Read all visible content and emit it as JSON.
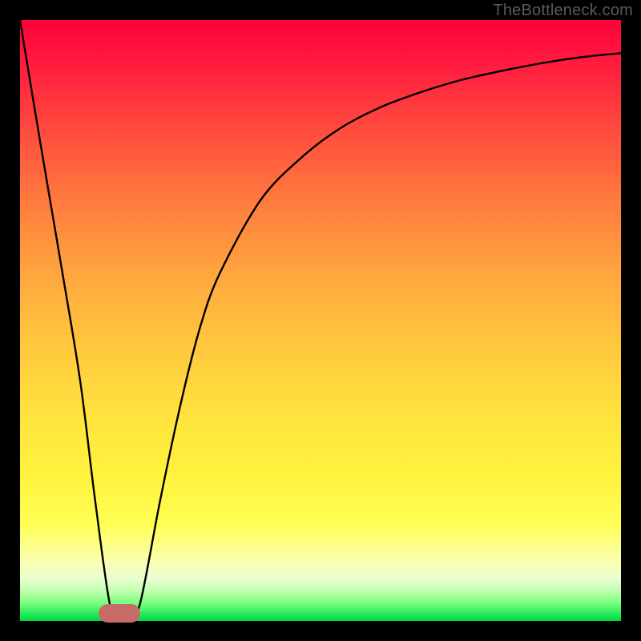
{
  "watermark": "TheBottleneck.com",
  "chart_data": {
    "type": "line",
    "title": "",
    "xlabel": "",
    "ylabel": "",
    "xlim": [
      0,
      1
    ],
    "ylim": [
      0,
      1
    ],
    "series": [
      {
        "name": "curve",
        "x": [
          0.0,
          0.033,
          0.067,
          0.1,
          0.125,
          0.15,
          0.167,
          0.183,
          0.2,
          0.233,
          0.267,
          0.3,
          0.333,
          0.4,
          0.467,
          0.533,
          0.6,
          0.667,
          0.733,
          0.8,
          0.867,
          0.933,
          1.0
        ],
        "y": [
          1.0,
          0.8,
          0.6,
          0.4,
          0.2,
          0.025,
          0.01,
          0.01,
          0.03,
          0.2,
          0.36,
          0.49,
          0.58,
          0.7,
          0.77,
          0.82,
          0.855,
          0.88,
          0.9,
          0.915,
          0.928,
          0.938,
          0.945
        ]
      }
    ],
    "marker": {
      "x_center": 0.165,
      "y_center": 0.013,
      "width": 0.07,
      "height": 0.03
    },
    "background_gradient": {
      "orientation": "vertical",
      "stops": [
        {
          "pos": 0.0,
          "color": "#ff003a"
        },
        {
          "pos": 0.5,
          "color": "#ffc73e"
        },
        {
          "pos": 0.85,
          "color": "#ffff55"
        },
        {
          "pos": 1.0,
          "color": "#00d948"
        }
      ]
    }
  }
}
